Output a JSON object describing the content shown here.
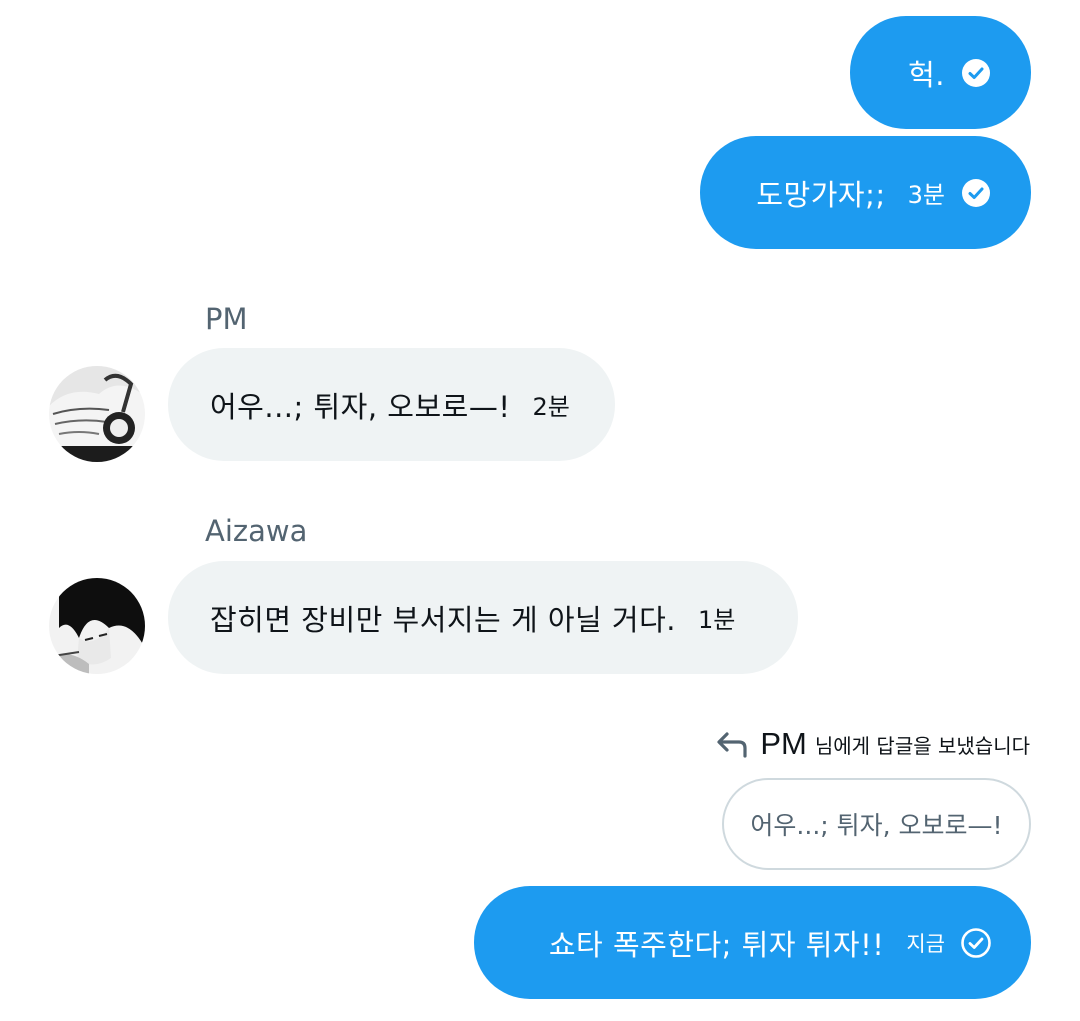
{
  "messages": [
    {
      "text": "헉.",
      "status_icon": "check-filled-icon"
    },
    {
      "text": "도망가자;;",
      "time": "3분",
      "status_icon": "check-filled-icon"
    },
    {
      "sender": "PM",
      "text": "어우...; 튀자, 오보로—!",
      "time": "2분"
    },
    {
      "sender": "Aizawa",
      "text": "잡히면 장비만 부서지는 게 아닐 거다.",
      "time": "1분"
    }
  ],
  "reply": {
    "to_name": "PM",
    "note": "님에게 답글을 보냈습니다",
    "quoted_text": "어우...; 튀자, 오보로—!",
    "text": "쇼타 폭주한다; 튀자 튀자!!",
    "time": "지금",
    "status_icon": "check-outline-icon"
  },
  "colors": {
    "outgoing_bubble": "#1d9bf0",
    "incoming_bubble": "#eff3f4",
    "sender_name": "#536471",
    "quote_border": "#cfd9de"
  }
}
